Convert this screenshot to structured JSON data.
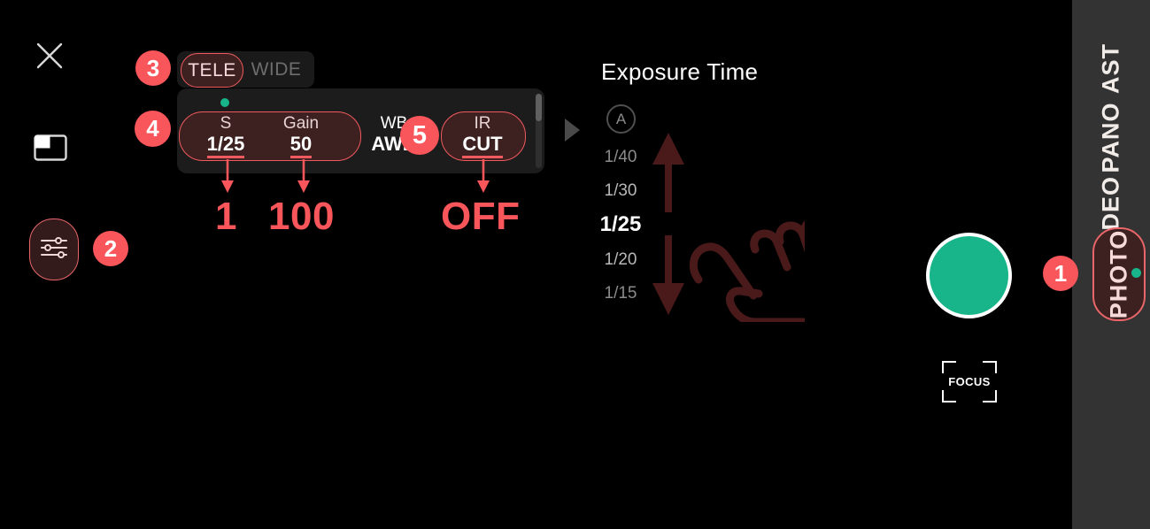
{
  "sidebar": {
    "modes": [
      {
        "id": "ast",
        "label": "AST"
      },
      {
        "id": "pano",
        "label": "PANO"
      },
      {
        "id": "video",
        "label": "VIDEO"
      },
      {
        "id": "photo",
        "label": "PHOTO",
        "active": true
      }
    ],
    "background_color": "#333333",
    "active_pill_border": "#e8666a",
    "active_dot_color": "#17b589"
  },
  "left_controls": {
    "close_icon": "close-x-icon",
    "pip_icon": "picture-in-picture-icon",
    "settings_icon": "sliders-settings-icon"
  },
  "lens_tabs": {
    "tele_label": "TELE",
    "wide_label": "WIDE",
    "selected": "TELE"
  },
  "settings_panel": {
    "status_dot_color": "#17b589",
    "fields": [
      {
        "key": "S",
        "value": "1/25",
        "underlined": true,
        "in_pill": true
      },
      {
        "key": "Gain",
        "value": "50",
        "underlined": true,
        "in_pill": true
      },
      {
        "key": "WB",
        "value": "AWB",
        "underlined": false,
        "in_pill": false
      },
      {
        "key": "IR",
        "value": "CUT",
        "underlined": true,
        "in_pill": true
      }
    ],
    "next_arrow_icon": "chevron-right-triangle-icon",
    "scrollbar": "vertical-scrollbar"
  },
  "exposure": {
    "title": "Exposure Time",
    "auto_label": "A",
    "values": [
      "1/40",
      "1/30",
      "1/25",
      "1/20",
      "1/15"
    ],
    "selected": "1/25",
    "gesture_icon": "swipe-up-down-hand-icon"
  },
  "capture": {
    "shutter_button": "shutter-button",
    "shutter_color": "#17b589",
    "focus_label": "FOCUS"
  },
  "annotations": {
    "badges": [
      {
        "id": "1",
        "label": "1"
      },
      {
        "id": "2",
        "label": "2"
      },
      {
        "id": "3",
        "label": "3"
      },
      {
        "id": "4",
        "label": "4"
      },
      {
        "id": "5",
        "label": "5"
      }
    ],
    "callouts": [
      {
        "id": "shutter-callout",
        "label": "1"
      },
      {
        "id": "gain-callout",
        "label": "100"
      },
      {
        "id": "ir-callout",
        "label": "OFF"
      }
    ],
    "color": "#f9565b"
  }
}
